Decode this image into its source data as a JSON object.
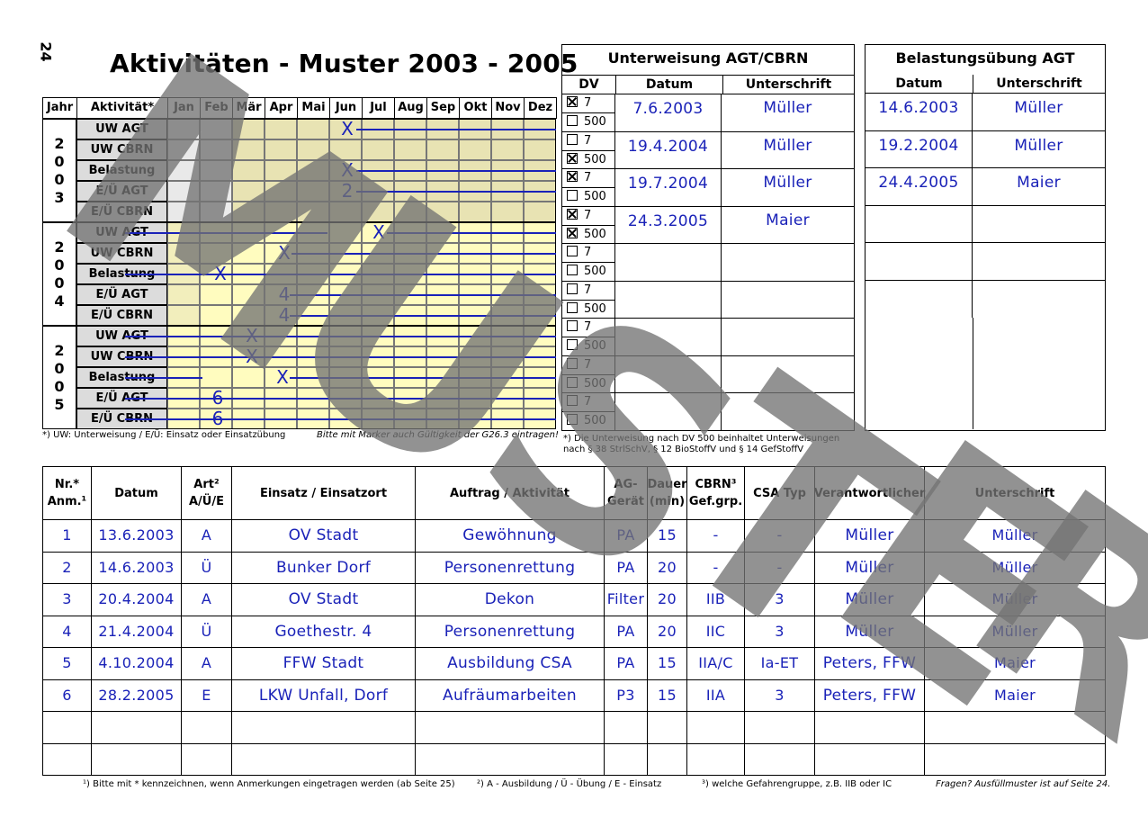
{
  "page_number": "24",
  "title": "Aktivitäten - Muster 2003 - 2005",
  "calendar": {
    "col_year": "Jahr",
    "col_activity": "Aktivität*",
    "months": [
      "Jan",
      "Feb",
      "Mär",
      "Apr",
      "Mai",
      "Jun",
      "Jul",
      "Aug",
      "Sep",
      "Okt",
      "Nov",
      "Dez"
    ],
    "years": [
      {
        "year_chars": [
          "2",
          "0",
          "0",
          "3"
        ],
        "rows": [
          "UW AGT",
          "UW CBRN",
          "Belastung",
          "E/Ü AGT",
          "E/Ü CBRN"
        ]
      },
      {
        "year_chars": [
          "2",
          "0",
          "0",
          "4"
        ],
        "rows": [
          "UW AGT",
          "UW CBRN",
          "Belastung",
          "E/Ü AGT",
          "E/Ü CBRN"
        ]
      },
      {
        "year_chars": [
          "2",
          "0",
          "0",
          "5"
        ],
        "rows": [
          "UW AGT",
          "UW CBRN",
          "Belastung",
          "E/Ü AGT",
          "E/Ü CBRN"
        ]
      }
    ],
    "marks": [
      "X",
      "X",
      "2",
      "X",
      "X",
      "X",
      "4",
      "4",
      "X",
      "X",
      "X",
      "6",
      "6"
    ],
    "footnote_left": "*) UW: Unterweisung / E/Ü: Einsatz oder Einsatzübung",
    "footnote_right": "Bitte mit Marker auch Gültigkeit der G26.3 eintragen!",
    "line_color": "#1a22b8"
  },
  "unterweisung": {
    "title": "Unterweisung AGT/CBRN",
    "col_dv": "DV",
    "col_datum": "Datum",
    "col_unterschrift": "Unterschrift",
    "dv_options": [
      "7",
      "500"
    ],
    "rows": [
      {
        "checked": "7",
        "datum": "7.6.2003",
        "unterschrift": "Müller"
      },
      {
        "checked": "500",
        "datum": "19.4.2004",
        "unterschrift": "Müller"
      },
      {
        "checked": "7",
        "datum": "19.7.2004",
        "unterschrift": "Müller"
      },
      {
        "checked": "both",
        "datum": "24.3.2005",
        "unterschrift": "Maier"
      },
      {
        "checked": "",
        "datum": "",
        "unterschrift": ""
      },
      {
        "checked": "",
        "datum": "",
        "unterschrift": ""
      },
      {
        "checked": "",
        "datum": "",
        "unterschrift": ""
      },
      {
        "checked": "",
        "datum": "",
        "unterschrift": ""
      },
      {
        "checked": "",
        "datum": "",
        "unterschrift": ""
      }
    ],
    "footnote_line1": "*) Die Unterweisung nach DV 500 beinhaltet Unterweisungen",
    "footnote_line2": "nach § 38 StrlSchV, § 12 BioStoffV und § 14 GefStoffV"
  },
  "belastung": {
    "title": "Belastungsübung AGT",
    "col_datum": "Datum",
    "col_unterschrift": "Unterschrift",
    "rows": [
      {
        "datum": "14.6.2003",
        "unterschrift": "Müller"
      },
      {
        "datum": "19.2.2004",
        "unterschrift": "Müller"
      },
      {
        "datum": "24.4.2005",
        "unterschrift": "Maier"
      },
      {
        "datum": "",
        "unterschrift": ""
      },
      {
        "datum": "",
        "unterschrift": ""
      },
      {
        "datum": "",
        "unterschrift": ""
      }
    ]
  },
  "einsatz": {
    "headers": {
      "nr": [
        "Nr.*",
        "Anm.¹"
      ],
      "datum": "Datum",
      "art": [
        "Art²",
        "A/Ü/E"
      ],
      "einsatzort": "Einsatz / Einsatzort",
      "auftrag": "Auftrag / Aktivität",
      "geraet": [
        "AG-",
        "Gerät"
      ],
      "dauer": [
        "Dauer",
        "(min)"
      ],
      "cbrn": [
        "CBRN³",
        "Gef.grp."
      ],
      "csa": "CSA Typ",
      "verantwortlich": "Verantwortlicher",
      "unterschrift": "Unterschrift"
    },
    "rows": [
      {
        "nr": "1",
        "datum": "13.6.2003",
        "art": "A",
        "ort": "OV Stadt",
        "auftrag": "Gewöhnung",
        "geraet": "PA",
        "dauer": "15",
        "cbrn": "-",
        "csa": "-",
        "verantwortlich": "Müller",
        "unterschrift": "Müller"
      },
      {
        "nr": "2",
        "datum": "14.6.2003",
        "art": "Ü",
        "ort": "Bunker Dorf",
        "auftrag": "Personenrettung",
        "geraet": "PA",
        "dauer": "20",
        "cbrn": "-",
        "csa": "-",
        "verantwortlich": "Müller",
        "unterschrift": "Müller"
      },
      {
        "nr": "3",
        "datum": "20.4.2004",
        "art": "A",
        "ort": "OV Stadt",
        "auftrag": "Dekon",
        "geraet": "Filter",
        "dauer": "20",
        "cbrn": "IIB",
        "csa": "3",
        "verantwortlich": "Müller",
        "unterschrift": "Müller"
      },
      {
        "nr": "4",
        "datum": "21.4.2004",
        "art": "Ü",
        "ort": "Goethestr. 4",
        "auftrag": "Personenrettung",
        "geraet": "PA",
        "dauer": "20",
        "cbrn": "IIC",
        "csa": "3",
        "verantwortlich": "Müller",
        "unterschrift": "Müller"
      },
      {
        "nr": "5",
        "datum": "4.10.2004",
        "art": "A",
        "ort": "FFW Stadt",
        "auftrag": "Ausbildung CSA",
        "geraet": "PA",
        "dauer": "15",
        "cbrn": "IIA/C",
        "csa": "Ia-ET",
        "verantwortlich": "Peters, FFW",
        "unterschrift": "Maier"
      },
      {
        "nr": "6",
        "datum": "28.2.2005",
        "art": "E",
        "ort": "LKW Unfall, Dorf",
        "auftrag": "Aufräumarbeiten",
        "geraet": "P3",
        "dauer": "15",
        "cbrn": "IIA",
        "csa": "3",
        "verantwortlich": "Peters, FFW",
        "unterschrift": "Maier"
      },
      {
        "nr": "",
        "datum": "",
        "art": "",
        "ort": "",
        "auftrag": "",
        "geraet": "",
        "dauer": "",
        "cbrn": "",
        "csa": "",
        "verantwortlich": "",
        "unterschrift": ""
      },
      {
        "nr": "",
        "datum": "",
        "art": "",
        "ort": "",
        "auftrag": "",
        "geraet": "",
        "dauer": "",
        "cbrn": "",
        "csa": "",
        "verantwortlich": "",
        "unterschrift": ""
      }
    ]
  },
  "footnotes": {
    "f1": "¹) Bitte mit * kennzeichnen, wenn Anmerkungen eingetragen werden (ab Seite 25)",
    "f2": "²) A - Ausbildung / Ü - Übung / E - Einsatz",
    "f3": "³) welche Gefahrengruppe, z.B. IIB oder IC",
    "f4": "Fragen? Ausfüllmuster ist auf Seite 24."
  },
  "watermark": [
    "M",
    "U",
    "S",
    "T",
    "E",
    "R"
  ],
  "colors": {
    "ink": "#1a22b8",
    "highlight": "#fffcbf",
    "watermark": "#737373"
  }
}
